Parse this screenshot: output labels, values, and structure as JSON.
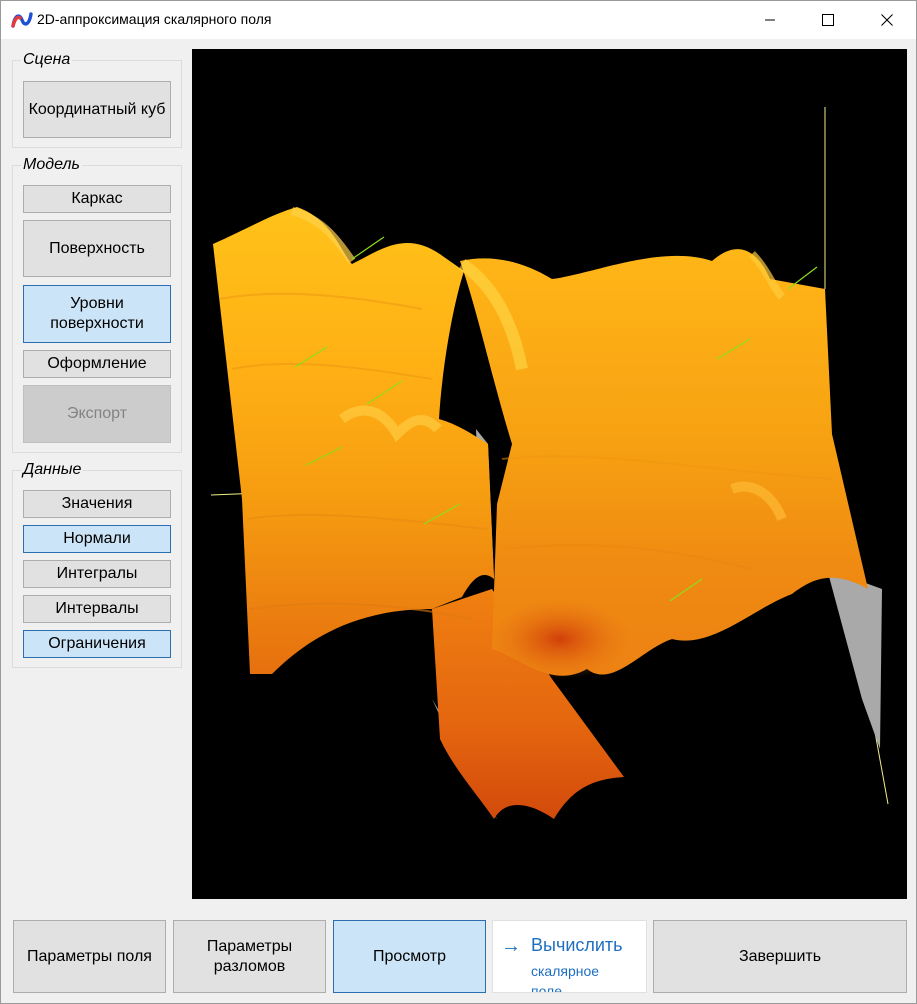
{
  "window": {
    "title": "2D-аппроксимация скалярного поля",
    "controls": [
      "minimize-icon",
      "maximize-icon",
      "close-icon"
    ]
  },
  "sidebar": {
    "scene": {
      "label": "Сцена",
      "buttons": [
        {
          "label": "Координатный куб",
          "state": "normal"
        }
      ]
    },
    "model": {
      "label": "Модель",
      "buttons": [
        {
          "label": "Каркас",
          "state": "normal"
        },
        {
          "label": "Поверхность",
          "state": "normal"
        },
        {
          "label": "Уровни поверхности",
          "state": "active"
        },
        {
          "label": "Оформление",
          "state": "normal"
        },
        {
          "label": "Экспорт",
          "state": "disabled"
        }
      ]
    },
    "data": {
      "label": "Данные",
      "buttons": [
        {
          "label": "Значения",
          "state": "normal"
        },
        {
          "label": "Нормали",
          "state": "active"
        },
        {
          "label": "Интегралы",
          "state": "normal"
        },
        {
          "label": "Интервалы",
          "state": "normal"
        },
        {
          "label": "Ограничения",
          "state": "active"
        }
      ]
    }
  },
  "viewport": {
    "background": "#000000",
    "surface_colors": [
      "#ffc21a",
      "#ffad12",
      "#f79a10",
      "#ef8412",
      "#e56a10",
      "#d9500c"
    ],
    "fault_color": "#a9a9a9",
    "normal_color": "#8fdc1c",
    "axis_color": "#f0f08a"
  },
  "footer": {
    "field_params": "Параметры поля",
    "fault_params": "Параметры разломов",
    "view": "Просмотр",
    "compute": {
      "title": "Вычислить",
      "note": "скалярное поле",
      "icon": "arrow-right-icon"
    },
    "finish": "Завершить"
  },
  "accent": "#1e6fc0",
  "active_button_bg": "#cce4f7"
}
